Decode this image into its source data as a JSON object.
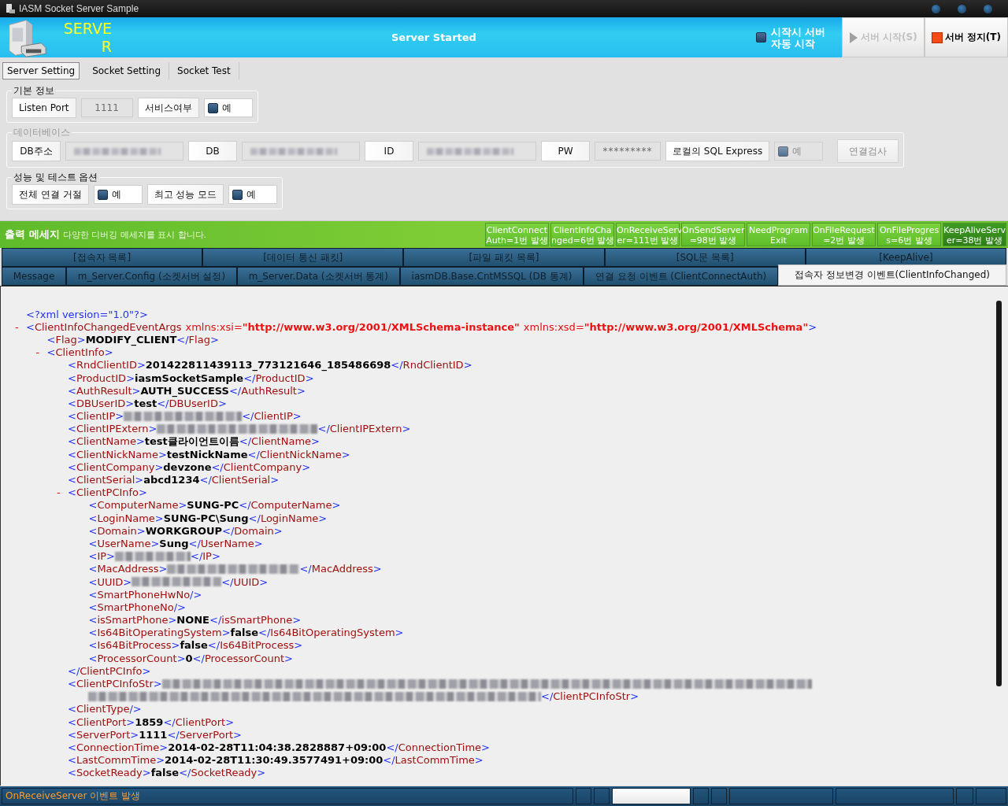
{
  "window": {
    "title": "IASM Socket Server Sample"
  },
  "header": {
    "logo_text": "SERVER",
    "status": "Server Started",
    "auto_start": {
      "label": "시작시 서버 자동 시작",
      "checked": false
    },
    "buttons": [
      {
        "label": "서버 시작(S)",
        "kind": "start",
        "disabled": true
      },
      {
        "label": "서버 정지(T)",
        "kind": "stop",
        "disabled": false
      }
    ]
  },
  "tabs": [
    {
      "label": "Server Setting",
      "selected": true
    },
    {
      "label": "Socket Setting",
      "selected": false
    },
    {
      "label": "Socket Test",
      "selected": false
    }
  ],
  "groups": [
    {
      "title": "기본 정보",
      "disabled": false,
      "items": [
        {
          "kind": "label",
          "text": "Listen Port"
        },
        {
          "kind": "field",
          "value": "1111"
        },
        {
          "kind": "label",
          "text": "서비스여부"
        },
        {
          "kind": "checkbox",
          "label": "예",
          "checked": false
        }
      ]
    },
    {
      "title": "데이터베이스",
      "disabled": true,
      "items": [
        {
          "kind": "label",
          "text": "DB주소"
        },
        {
          "kind": "blurred"
        },
        {
          "kind": "label",
          "text": "DB"
        },
        {
          "kind": "blurred"
        },
        {
          "kind": "label",
          "text": "ID"
        },
        {
          "kind": "blurred"
        },
        {
          "kind": "label",
          "text": "PW"
        },
        {
          "kind": "field",
          "value": "*********"
        },
        {
          "kind": "label",
          "text": "로컬의 SQL Express"
        },
        {
          "kind": "checkbox",
          "label": "예",
          "checked": false
        },
        {
          "kind": "button",
          "text": "연결검사"
        }
      ]
    },
    {
      "title": "성능 및 테스트 옵션",
      "disabled": false,
      "items": [
        {
          "kind": "label",
          "text": "전체 연결 거절"
        },
        {
          "kind": "checkbox",
          "label": "예",
          "checked": false
        },
        {
          "kind": "label",
          "text": "최고 성능 모드"
        },
        {
          "kind": "checkbox",
          "label": "예",
          "checked": false
        }
      ]
    }
  ],
  "output": {
    "title": "출력 메세지",
    "subtitle": "다양한 디버깅 메세지를 표시 합니다.",
    "counters": [
      {
        "lines": [
          "ClientConnect",
          "Auth=1번 발생"
        ]
      },
      {
        "lines": [
          "ClientInfoCha",
          "nged=6번 발생"
        ]
      },
      {
        "lines": [
          "OnReceiveServ",
          "er=111번 발생"
        ]
      },
      {
        "lines": [
          "OnSendServer",
          "=98번 발생"
        ]
      },
      {
        "lines": [
          "NeedProgram",
          "Exit"
        ]
      },
      {
        "lines": [
          "OnFileRequest",
          "=2번 발생"
        ]
      },
      {
        "lines": [
          "OnFileProgres",
          "s=6번 발생"
        ]
      },
      {
        "lines": [
          "KeepAliveServ",
          "er=38번 발생"
        ]
      }
    ]
  },
  "view_tabs": [
    [
      {
        "label": "[접속자 목록]",
        "selected": false
      },
      {
        "label": "[데이터 통신 패킷]",
        "selected": false
      },
      {
        "label": "[파일 패킷 목록]",
        "selected": false
      },
      {
        "label": "[SQL문 목록]",
        "selected": false
      },
      {
        "label": "[KeepAlive]",
        "selected": false
      }
    ],
    [
      {
        "label": "Message",
        "selected": false
      },
      {
        "label": "m_Server.Config (소켓서버 설정)",
        "selected": false
      },
      {
        "label": "m_Server.Data  (소켓서버 통계)",
        "selected": false
      },
      {
        "label": "iasmDB.Base.CntMSSQL  (DB 통계)",
        "selected": false
      },
      {
        "label": "연결 요청 이벤트 (ClientConnectAuth)",
        "selected": false
      },
      {
        "label": "접속자 정보변경 이벤트(ClientInfoChanged)",
        "selected": true
      }
    ]
  ],
  "xml": {
    "declaration": "<?xml version=\"1.0\"?>",
    "root": {
      "kind": "element",
      "toggle": "-",
      "open": "<ClientInfoChangedEventArgs",
      "attrs": [
        {
          "name": "xmlns:xsi=",
          "value": "\"http://www.w3.org/2001/XMLSchema-instance\""
        },
        {
          "name": "xmlns:xsd=",
          "value": "\"http://www.w3.org/2001/XMLSchema\""
        }
      ],
      "open_end": ">",
      "children": [
        {
          "kind": "text",
          "open": "<Flag>",
          "value": "MODIFY_CLIENT",
          "close": "</Flag>"
        },
        {
          "kind": "element",
          "toggle": "-",
          "open": "<ClientInfo>",
          "children": [
            {
              "kind": "text",
              "open": "<RndClientID>",
              "value": "201422811439113_773121646_185486698",
              "close": "</RndClientID>"
            },
            {
              "kind": "text",
              "open": "<ProductID>",
              "value": "iasmSocketSample",
              "close": "</ProductID>"
            },
            {
              "kind": "text",
              "open": "<AuthResult>",
              "value": "AUTH_SUCCESS",
              "close": "</AuthResult>"
            },
            {
              "kind": "text",
              "open": "<DBUserID>",
              "value": "test",
              "close": "</DBUserID>"
            },
            {
              "kind": "redacted",
              "open": "<ClientIP>",
              "close": "</ClientIP>"
            },
            {
              "kind": "redacted",
              "open": "<ClientIPExtern>",
              "close": "</ClientIPExtern>"
            },
            {
              "kind": "text",
              "open": "<ClientName>",
              "value": "test클라이언트이름",
              "close": "</ClientName>"
            },
            {
              "kind": "text",
              "open": "<ClientNickName>",
              "value": "testNickName",
              "close": "</ClientNickName>"
            },
            {
              "kind": "text",
              "open": "<ClientCompany>",
              "value": "devzone",
              "close": "</ClientCompany>"
            },
            {
              "kind": "text",
              "open": "<ClientSerial>",
              "value": "abcd1234",
              "close": "</ClientSerial>"
            },
            {
              "kind": "element",
              "toggle": "-",
              "open": "<ClientPCInfo>",
              "close": "</ClientPCInfo>",
              "children": [
                {
                  "kind": "text",
                  "open": "<ComputerName>",
                  "value": "SUNG-PC",
                  "close": "</ComputerName>"
                },
                {
                  "kind": "text",
                  "open": "<LoginName>",
                  "value": "SUNG-PC\\Sung",
                  "close": "</LoginName>"
                },
                {
                  "kind": "text",
                  "open": "<Domain>",
                  "value": "WORKGROUP",
                  "close": "</Domain>"
                },
                {
                  "kind": "text",
                  "open": "<UserName>",
                  "value": "Sung",
                  "close": "</UserName>"
                },
                {
                  "kind": "redacted",
                  "open": "<IP>",
                  "close": "</IP>"
                },
                {
                  "kind": "redacted",
                  "open": "<MacAddress>",
                  "close": "</MacAddress>"
                },
                {
                  "kind": "redacted",
                  "open": "<UUID>",
                  "close": "</UUID>"
                },
                {
                  "kind": "empty",
                  "open": "<SmartPhoneHwNo/>"
                },
                {
                  "kind": "empty",
                  "open": "<SmartPhoneNo/>"
                },
                {
                  "kind": "text",
                  "open": "<isSmartPhone>",
                  "value": "NONE",
                  "close": "</isSmartPhone>"
                },
                {
                  "kind": "text",
                  "open": "<Is64BitOperatingSystem>",
                  "value": "false",
                  "close": "</Is64BitOperatingSystem>"
                },
                {
                  "kind": "text",
                  "open": "<Is64BitProcess>",
                  "value": "false",
                  "close": "</Is64BitProcess>"
                },
                {
                  "kind": "text",
                  "open": "<ProcessorCount>",
                  "value": "0",
                  "close": "</ProcessorCount>"
                }
              ]
            },
            {
              "kind": "redacted_wrap",
              "open": "<ClientPCInfoStr>",
              "close": "</ClientPCInfoStr>"
            },
            {
              "kind": "empty",
              "open": "<ClientType/>"
            },
            {
              "kind": "text",
              "open": "<ClientPort>",
              "value": "1859",
              "close": "</ClientPort>"
            },
            {
              "kind": "text",
              "open": "<ServerPort>",
              "value": "1111",
              "close": "</ServerPort>"
            },
            {
              "kind": "text",
              "open": "<ConnectionTime>",
              "value": "2014-02-28T11:04:38.2828887+09:00",
              "close": "</ConnectionTime>"
            },
            {
              "kind": "text",
              "open": "<LastCommTime>",
              "value": "2014-02-28T11:30:49.3577491+09:00",
              "close": "</LastCommTime>"
            },
            {
              "kind": "text",
              "open": "<SocketReady>",
              "value": "false",
              "close": "</SocketReady>"
            }
          ]
        }
      ]
    }
  },
  "status_bar": {
    "message": "OnReceiveServer 이벤트 발생"
  }
}
